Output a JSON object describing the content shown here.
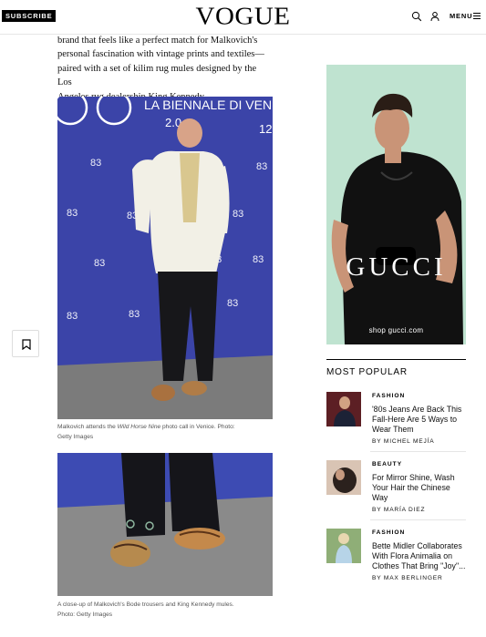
{
  "header": {
    "subscribe_label": "SUBSCRIBE",
    "logo": "VOGUE",
    "search_icon": "search-icon",
    "account_icon": "user-icon",
    "menu_label": "MENU",
    "menu_icon": "hamburger-icon"
  },
  "article": {
    "paragraph_lines": [
      "brand that feels like a perfect match for Malkovich's",
      "personal fascination with vintage prints and textiles—",
      "paired with a set of kilim rug mules designed by the Los"
    ],
    "paragraph_last_prefix": "Angeles rug dealership ",
    "paragraph_link": "King Kennedy",
    "paragraph_last_suffix": ".",
    "backdrop_text_line1": "LA BIENNALE DI VENEZ",
    "backdrop_text_line2": "2.0",
    "backdrop_text_line3": "12",
    "backdrop_logo_text": "83",
    "caption1_prefix": "Malkovich attends the ",
    "caption1_italic": "Wild Horse Nine",
    "caption1_suffix": " photo call in Venice.   Photo:",
    "caption1_line2": "Getty Images",
    "caption2_line1": "A close-up of Malkovich's Bode trousers and King Kennedy mules.",
    "caption2_line2": "Photo: Getty Images",
    "bookmark_icon": "bookmark-icon"
  },
  "ad": {
    "brand": "GUCCI",
    "cta": "shop gucci.com"
  },
  "most_popular": {
    "title": "MOST POPULAR",
    "items": [
      {
        "category": "FASHION",
        "headline_lines": [
          "'80s Jeans Are Back This",
          "Fall-Here Are 5 Ways to",
          "Wear Them"
        ],
        "byline": "BY MICHEL MEJÍA"
      },
      {
        "category": "BEAUTY",
        "headline_lines": [
          "For Mirror Shine, Wash",
          "Your Hair the Chinese",
          "Way"
        ],
        "byline": "BY MARÍA DIEZ"
      },
      {
        "category": "FASHION",
        "headline_lines": [
          "Bette Midler Collaborates",
          "With Flora Animalia on",
          "Clothes That Bring \"Joy\"..."
        ],
        "byline": "BY MAX BERLINGER"
      }
    ]
  },
  "colors": {
    "backdrop_blue": "#3b44a8",
    "carpet_gray": "#7b7b7b",
    "ad_green": "#bfe3d0"
  }
}
